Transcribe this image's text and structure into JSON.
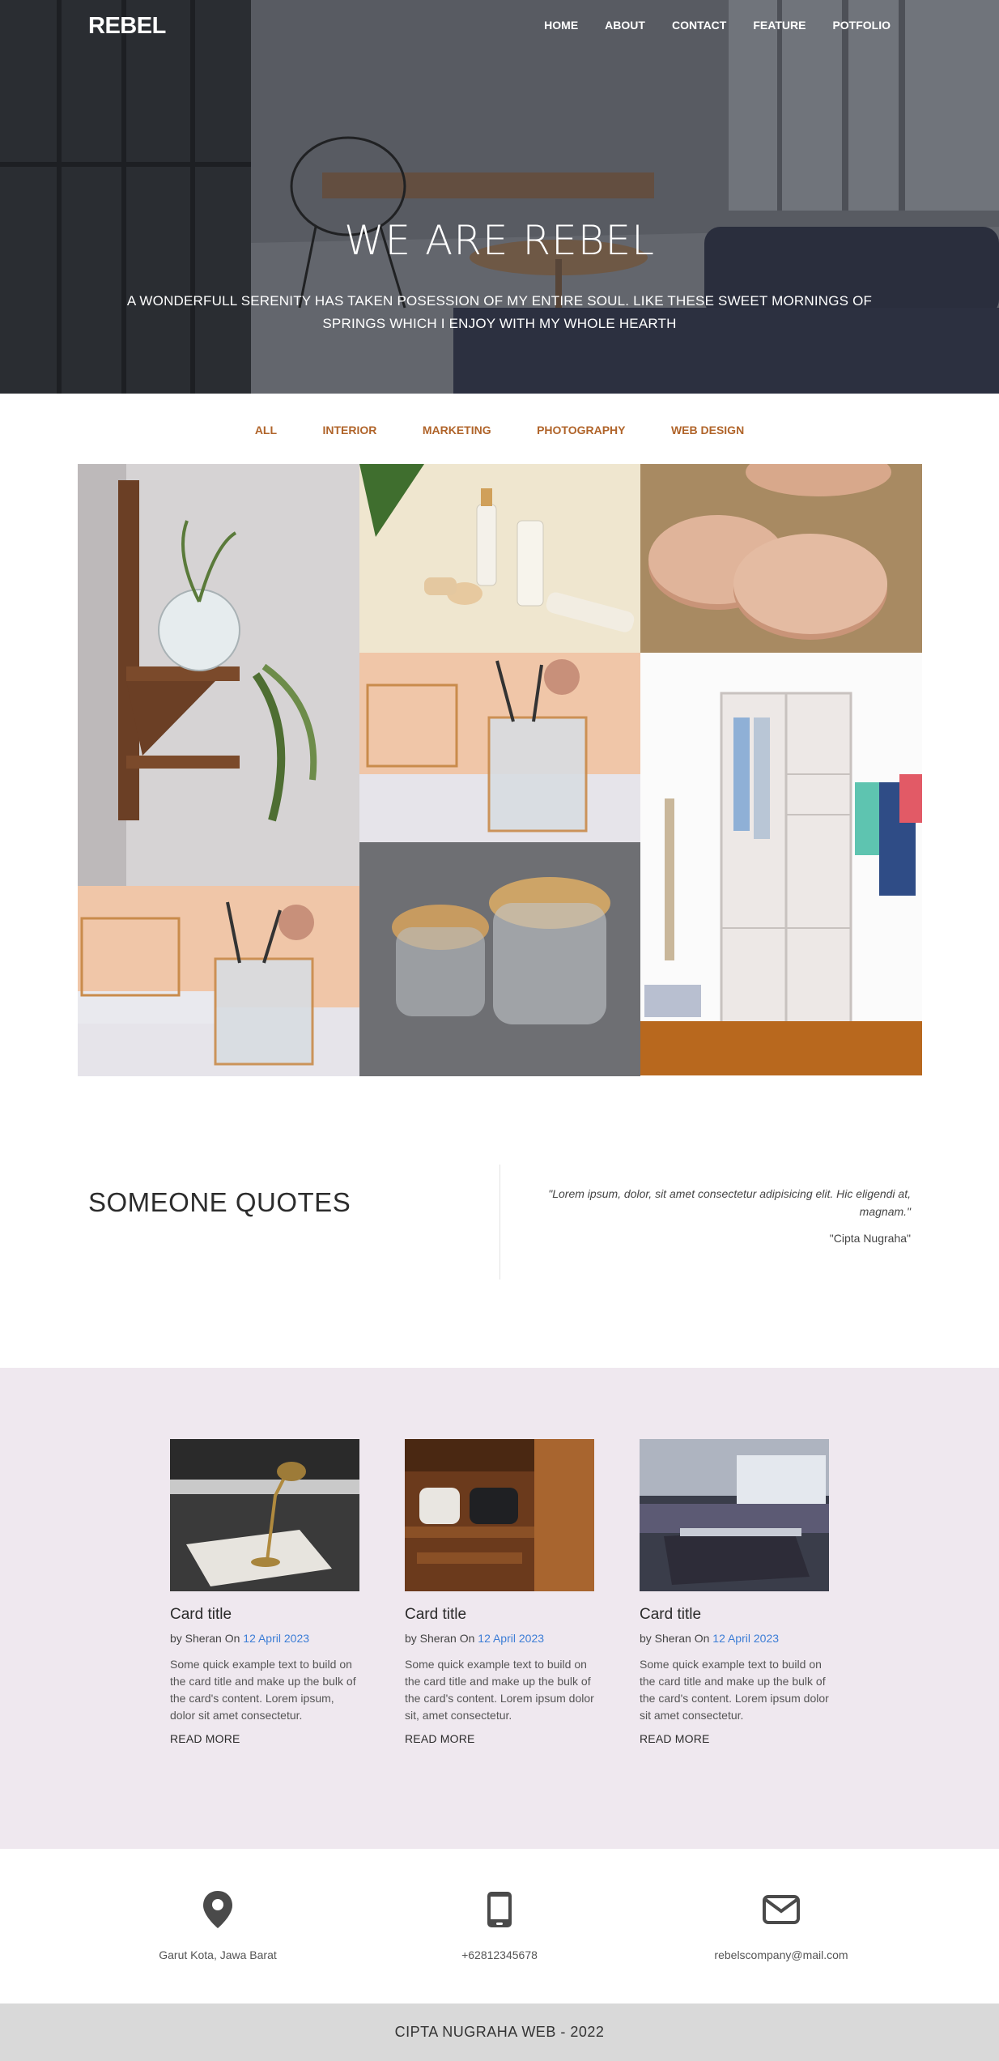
{
  "header": {
    "brand": "REBEL",
    "nav": [
      "HOME",
      "ABOUT",
      "CONTACT",
      "FEATURE",
      "POTFOLIO"
    ]
  },
  "hero": {
    "title": "WE ARE REBEL",
    "subtitle": "A WONDERFULL SERENITY HAS TAKEN POSESSION OF MY ENTIRE SOUL. LIKE THESE SWEET MORNINGS OF SPRINGS WHICH I ENJOY WITH MY WHOLE HEARTH"
  },
  "filters": [
    "ALL",
    "INTERIOR",
    "MARKETING",
    "PHOTOGRAPHY",
    "WEB DESIGN"
  ],
  "quotes": {
    "title": "SOMEONE QUOTES",
    "text": "\"Lorem ipsum, dolor, sit amet consectetur adipisicing elit. Hic eligendi at, magnam.\"",
    "author": "\"Cipta Nugraha\""
  },
  "cards": [
    {
      "title": "Card title",
      "by": "by Sheran On ",
      "date": "12 April 2023",
      "text": "Some quick example text to build on the card title and make up the bulk of the card's content. Lorem ipsum, dolor sit amet consectetur.",
      "more": "READ MORE"
    },
    {
      "title": "Card title",
      "by": "by Sheran On ",
      "date": "12 April 2023",
      "text": "Some quick example text to build on the card title and make up the bulk of the card's content. Lorem ipsum dolor sit, amet consectetur.",
      "more": "READ MORE"
    },
    {
      "title": "Card title",
      "by": "by Sheran On ",
      "date": "12 April 2023",
      "text": "Some quick example text to build on the card title and make up the bulk of the card's content. Lorem ipsum dolor sit amet consectetur.",
      "more": "READ MORE"
    }
  ],
  "contact": {
    "location": "Garut Kota, Jawa Barat",
    "phone": "+62812345678",
    "email": "rebelscompany@mail.com",
    "icons": [
      "map-pin-icon",
      "mobile-phone-icon",
      "envelope-icon"
    ]
  },
  "footer": {
    "text": "CIPTA NUGRAHA WEB - 2022"
  },
  "colors": {
    "accent": "#b0642a",
    "link": "#3c7dd6",
    "cards_bg": "#efe8ef",
    "footer_bg": "#d9d9d9"
  }
}
